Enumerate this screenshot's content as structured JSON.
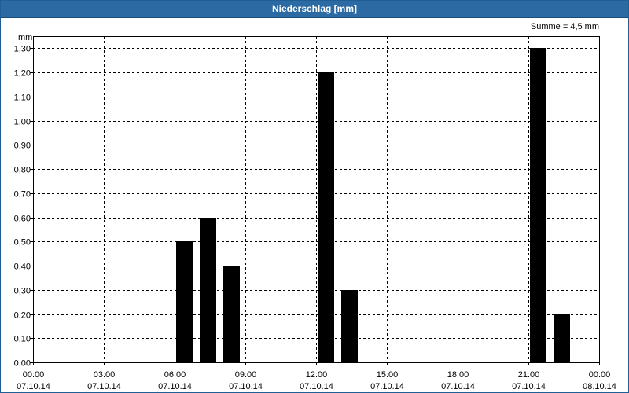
{
  "window": {
    "title": "Niederschlag [mm]"
  },
  "summary": {
    "text": "Summe = 4,5 mm"
  },
  "colors": {
    "title_bar": "#2b6aa3",
    "bar": "#000000",
    "grid": "#000000"
  },
  "chart_data": {
    "type": "bar",
    "title": "Niederschlag [mm]",
    "ylabel": "mm",
    "xlabel": "",
    "ylim": [
      0,
      1.35
    ],
    "grid": true,
    "y_ticks": [
      "0,00",
      "0,10",
      "0,20",
      "0,30",
      "0,40",
      "0,50",
      "0,60",
      "0,70",
      "0,80",
      "0,90",
      "1,00",
      "1,10",
      "1,20",
      "1,30"
    ],
    "y_tick_values": [
      0,
      0.1,
      0.2,
      0.3,
      0.4,
      0.5,
      0.6,
      0.7,
      0.8,
      0.9,
      1.0,
      1.1,
      1.2,
      1.3
    ],
    "x_ticks": [
      {
        "time": "00:00",
        "date": "07.10.14",
        "hour": 0
      },
      {
        "time": "03:00",
        "date": "07.10.14",
        "hour": 3
      },
      {
        "time": "06:00",
        "date": "07.10.14",
        "hour": 6
      },
      {
        "time": "09:00",
        "date": "07.10.14",
        "hour": 9
      },
      {
        "time": "12:00",
        "date": "07.10.14",
        "hour": 12
      },
      {
        "time": "15:00",
        "date": "07.10.14",
        "hour": 15
      },
      {
        "time": "18:00",
        "date": "07.10.14",
        "hour": 18
      },
      {
        "time": "21:00",
        "date": "07.10.14",
        "hour": 21
      },
      {
        "time": "00:00",
        "date": "08.10.14",
        "hour": 24
      }
    ],
    "xlim": [
      0,
      24
    ],
    "bars": [
      {
        "hour": 6,
        "value": 0.5
      },
      {
        "hour": 7,
        "value": 0.6
      },
      {
        "hour": 8,
        "value": 0.4
      },
      {
        "hour": 12,
        "value": 1.2
      },
      {
        "hour": 13,
        "value": 0.3
      },
      {
        "hour": 21,
        "value": 1.3
      },
      {
        "hour": 22,
        "value": 0.2
      }
    ],
    "bar_width_hours": 0.7,
    "summary": "Summe = 4,5 mm"
  }
}
